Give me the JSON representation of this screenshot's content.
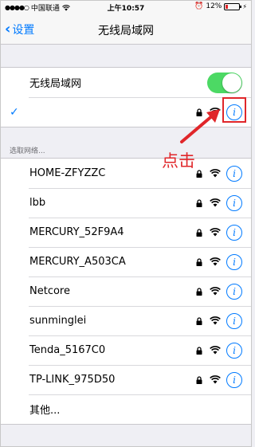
{
  "status_bar": {
    "signal": "●●●●○",
    "carrier": "中国联通",
    "time": "上午10:57",
    "battery": "12%"
  },
  "nav": {
    "back_label": "设置",
    "title": "无线局域网"
  },
  "wifi_toggle": {
    "label": "无线局域网",
    "on": true
  },
  "connected": {
    "check": "✓",
    "name": ""
  },
  "section_header": "选取网络...",
  "networks": [
    {
      "name": "HOME-ZFYZZC",
      "locked": true
    },
    {
      "name": "lbb",
      "locked": true
    },
    {
      "name": "MERCURY_52F9A4",
      "locked": true
    },
    {
      "name": "MERCURY_A503CA",
      "locked": true
    },
    {
      "name": "Netcore",
      "locked": true
    },
    {
      "name": "sunminglei",
      "locked": true
    },
    {
      "name": "Tenda_5167C0",
      "locked": true
    },
    {
      "name": "TP-LINK_975D50",
      "locked": true
    }
  ],
  "other_label": "其他...",
  "annotation": {
    "text": "点击",
    "color": "#e0262a"
  },
  "accent_color": "#007aff",
  "icons": {
    "lock": "lock-icon",
    "wifi": "wifi-icon",
    "info": "info-icon"
  }
}
